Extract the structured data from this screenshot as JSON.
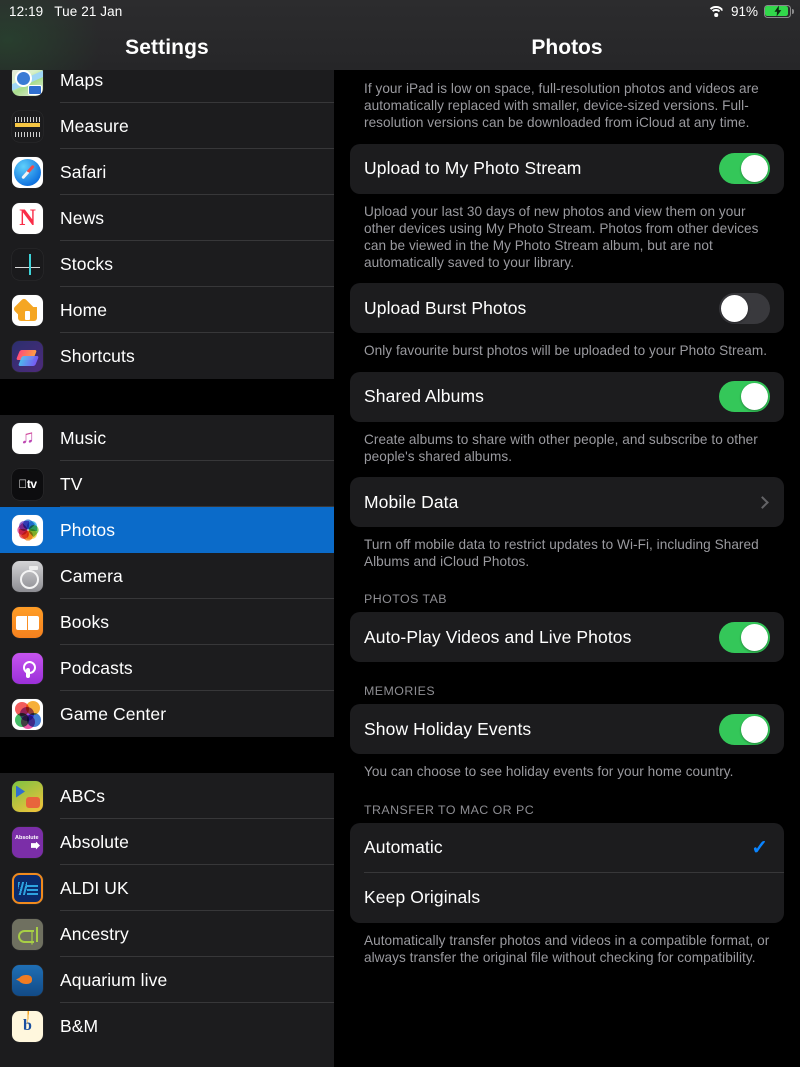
{
  "status_bar": {
    "time": "12:19",
    "date": "Tue 21 Jan",
    "wifi_icon": "wifi-icon",
    "battery_percent": "91%",
    "battery_icon": "battery-charging-icon"
  },
  "sidebar": {
    "title": "Settings",
    "selected": "Photos",
    "groups": [
      {
        "items": [
          {
            "label": "Maps",
            "icon": "maps-app-icon"
          },
          {
            "label": "Measure",
            "icon": "measure-app-icon"
          },
          {
            "label": "Safari",
            "icon": "safari-app-icon"
          },
          {
            "label": "News",
            "icon": "news-app-icon"
          },
          {
            "label": "Stocks",
            "icon": "stocks-app-icon"
          },
          {
            "label": "Home",
            "icon": "home-app-icon"
          },
          {
            "label": "Shortcuts",
            "icon": "shortcuts-app-icon"
          }
        ]
      },
      {
        "items": [
          {
            "label": "Music",
            "icon": "music-app-icon"
          },
          {
            "label": "TV",
            "icon": "tv-app-icon"
          },
          {
            "label": "Photos",
            "icon": "photos-app-icon",
            "selected": true
          },
          {
            "label": "Camera",
            "icon": "camera-app-icon"
          },
          {
            "label": "Books",
            "icon": "books-app-icon"
          },
          {
            "label": "Podcasts",
            "icon": "podcasts-app-icon"
          },
          {
            "label": "Game Center",
            "icon": "game-center-app-icon"
          }
        ]
      },
      {
        "items": [
          {
            "label": "ABCs",
            "icon": "abcs-app-icon"
          },
          {
            "label": "Absolute",
            "icon": "absolute-radio-app-icon"
          },
          {
            "label": "ALDI UK",
            "icon": "aldi-uk-app-icon"
          },
          {
            "label": "Ancestry",
            "icon": "ancestry-app-icon"
          },
          {
            "label": "Aquarium live",
            "icon": "aquarium-live-app-icon"
          },
          {
            "label": "B&M",
            "icon": "bm-app-icon"
          }
        ]
      }
    ]
  },
  "detail": {
    "title": "Photos",
    "icloud_footer": "If your iPad is low on space, full-resolution photos and videos are automatically replaced with smaller, device-sized versions. Full-resolution versions can be downloaded from iCloud at any time.",
    "photo_stream": {
      "label": "Upload to My Photo Stream",
      "value": "on",
      "footer": "Upload your last 30 days of new photos and view them on your other devices using My Photo Stream. Photos from other devices can be viewed in the My Photo Stream album, but are not automatically saved to your library."
    },
    "burst": {
      "label": "Upload Burst Photos",
      "value": "off",
      "footer": "Only favourite burst photos will be uploaded to your Photo Stream."
    },
    "shared_albums": {
      "label": "Shared Albums",
      "value": "on",
      "footer": "Create albums to share with other people, and subscribe to other people's shared albums."
    },
    "mobile_data": {
      "label": "Mobile Data",
      "disclosure_icon": "chevron-right-icon",
      "footer": "Turn off mobile data to restrict updates to Wi-Fi, including Shared Albums and iCloud Photos."
    },
    "photos_tab": {
      "header": "PHOTOS TAB",
      "autoplay": {
        "label": "Auto-Play Videos and Live Photos",
        "value": "on"
      }
    },
    "memories": {
      "header": "MEMORIES",
      "holiday": {
        "label": "Show Holiday Events",
        "value": "on"
      },
      "footer": "You can choose to see holiday events for your home country."
    },
    "transfer": {
      "header": "TRANSFER TO MAC OR PC",
      "options": [
        {
          "label": "Automatic",
          "selected": true,
          "check_icon": "checkmark-icon"
        },
        {
          "label": "Keep Originals",
          "selected": false
        }
      ],
      "footer": "Automatically transfer photos and videos in a compatible format, or always transfer the original file without checking for compatibility."
    }
  },
  "colors": {
    "accent_blue": "#0a84ff",
    "selection_blue": "#0b6bc9",
    "toggle_on_green": "#34c759",
    "toggle_off_gray": "#39393d",
    "card_bg": "#1c1c1e",
    "page_bg": "#000000"
  }
}
